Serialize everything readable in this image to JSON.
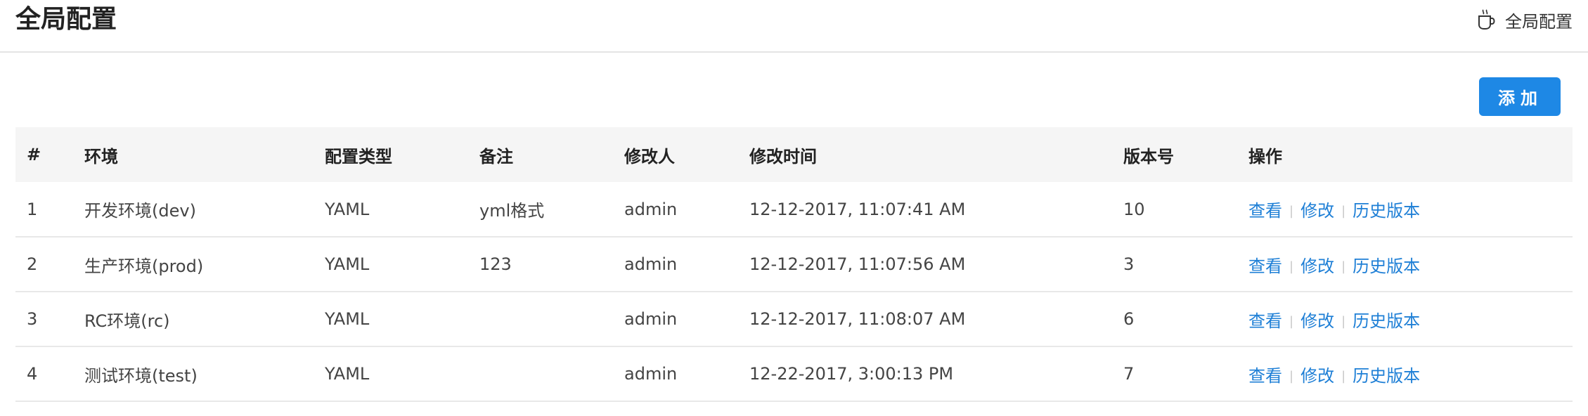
{
  "header": {
    "title": "全局配置",
    "breadcrumb": {
      "icon": "coffee-cup-icon",
      "label": "全局配置"
    }
  },
  "toolbar": {
    "add_label": "添加"
  },
  "colors": {
    "primary": "#1e88e5",
    "link": "#1e7fd6",
    "header_bg": "#f5f5f5",
    "divider": "#e8e8e8"
  },
  "table": {
    "columns": [
      "#",
      "环境",
      "配置类型",
      "备注",
      "修改人",
      "修改时间",
      "版本号",
      "操作"
    ],
    "rows": [
      {
        "index": "1",
        "env": "开发环境(dev)",
        "type": "YAML",
        "note": "yml格式",
        "user": "admin",
        "time": "12-12-2017, 11:07:41 AM",
        "version": "10"
      },
      {
        "index": "2",
        "env": "生产环境(prod)",
        "type": "YAML",
        "note": "123",
        "user": "admin",
        "time": "12-12-2017, 11:07:56 AM",
        "version": "3"
      },
      {
        "index": "3",
        "env": "RC环境(rc)",
        "type": "YAML",
        "note": "",
        "user": "admin",
        "time": "12-12-2017, 11:08:07 AM",
        "version": "6"
      },
      {
        "index": "4",
        "env": "测试环境(test)",
        "type": "YAML",
        "note": "",
        "user": "admin",
        "time": "12-22-2017, 3:00:13 PM",
        "version": "7"
      }
    ],
    "actions": {
      "view": "查看",
      "edit": "修改",
      "history": "历史版本"
    }
  }
}
